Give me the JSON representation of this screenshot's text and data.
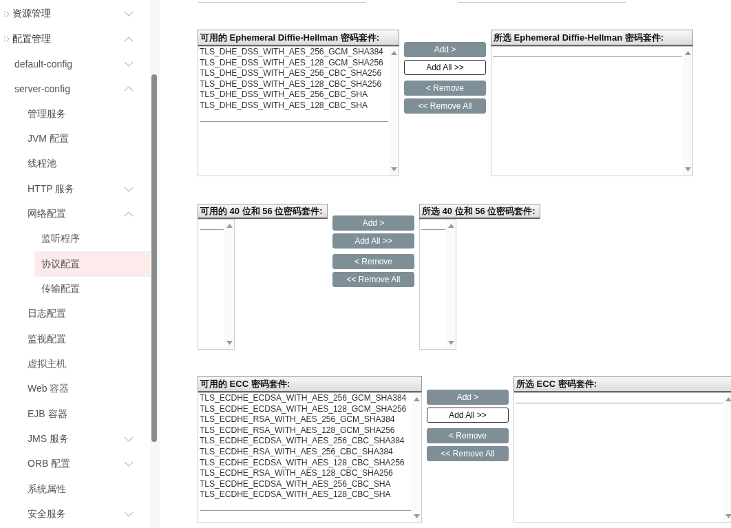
{
  "sidebar": {
    "items": [
      {
        "label": "资源管理",
        "selected": false,
        "expanded": false
      },
      {
        "label": "配置管理",
        "selected": false,
        "expanded": true,
        "children": [
          {
            "label": "default-config",
            "selected": false,
            "expanded": false
          },
          {
            "label": "server-config",
            "selected": false,
            "expanded": true,
            "children": [
              {
                "label": "管理服务",
                "selected": false
              },
              {
                "label": "JVM 配置",
                "selected": false
              },
              {
                "label": "线程池",
                "selected": false
              },
              {
                "label": "HTTP 服务",
                "selected": false,
                "expanded": false
              },
              {
                "label": "网络配置",
                "selected": false,
                "expanded": true,
                "children": [
                  {
                    "label": "监听程序",
                    "selected": false
                  },
                  {
                    "label": "协议配置",
                    "selected": true
                  },
                  {
                    "label": "传输配置",
                    "selected": false
                  }
                ]
              },
              {
                "label": "日志配置",
                "selected": false
              },
              {
                "label": "监视配置",
                "selected": false
              },
              {
                "label": "虚拟主机",
                "selected": false
              },
              {
                "label": "Web 容器",
                "selected": false
              },
              {
                "label": "EJB 容器",
                "selected": false
              },
              {
                "label": "JMS 服务",
                "selected": false,
                "expanded": false
              },
              {
                "label": "ORB 配置",
                "selected": false,
                "expanded": false
              },
              {
                "label": "系统属性",
                "selected": false
              },
              {
                "label": "安全服务",
                "selected": false,
                "expanded": false
              }
            ]
          }
        ]
      }
    ]
  },
  "sections": [
    {
      "available": {
        "title": "可用的 Ephemeral Diffie-Hellman 密码套件:",
        "options": [
          "TLS_DHE_DSS_WITH_AES_256_GCM_SHA384",
          "TLS_DHE_DSS_WITH_AES_128_GCM_SHA256",
          "TLS_DHE_DSS_WITH_AES_256_CBC_SHA256",
          "TLS_DHE_DSS_WITH_AES_128_CBC_SHA256",
          "TLS_DHE_DSS_WITH_AES_256_CBC_SHA",
          "TLS_DHE_DSS_WITH_AES_128_CBC_SHA"
        ]
      },
      "buttons": [
        {
          "label": "Add >",
          "disabled": true
        },
        {
          "label": "Add All >>",
          "disabled": false
        },
        {
          "label": "< Remove",
          "disabled": true
        },
        {
          "label": "<< Remove All",
          "disabled": true
        }
      ],
      "selected": {
        "title": "所选 Ephemeral Diffie-Hellman 密码套件:"
      }
    },
    {
      "available": {
        "title": "可用的 40 位和 56 位密码套件:"
      },
      "buttons": [
        {
          "label": "Add >",
          "disabled": true
        },
        {
          "label": "Add All >>",
          "disabled": true
        },
        {
          "label": "< Remove",
          "disabled": true
        },
        {
          "label": "<< Remove All",
          "disabled": true
        }
      ],
      "selected": {
        "title": "所选 40 位和 56 位密码套件:"
      }
    },
    {
      "available": {
        "title": "可用的 ECC 密码套件:",
        "options": [
          "TLS_ECDHE_ECDSA_WITH_AES_256_GCM_SHA384",
          "TLS_ECDHE_ECDSA_WITH_AES_128_GCM_SHA256",
          "TLS_ECDHE_RSA_WITH_AES_256_GCM_SHA384",
          "TLS_ECDHE_RSA_WITH_AES_128_GCM_SHA256",
          "TLS_ECDHE_ECDSA_WITH_AES_256_CBC_SHA384",
          "TLS_ECDHE_RSA_WITH_AES_256_CBC_SHA384",
          "TLS_ECDHE_ECDSA_WITH_AES_128_CBC_SHA256",
          "TLS_ECDHE_RSA_WITH_AES_128_CBC_SHA256",
          "TLS_ECDHE_ECDSA_WITH_AES_256_CBC_SHA",
          "TLS_ECDHE_ECDSA_WITH_AES_128_CBC_SHA"
        ]
      },
      "buttons": [
        {
          "label": "Add >",
          "disabled": true
        },
        {
          "label": "Add All >>",
          "disabled": false
        },
        {
          "label": "< Remove",
          "disabled": true
        },
        {
          "label": "<< Remove All",
          "disabled": true
        }
      ],
      "selected": {
        "title": "所选 ECC 密码套件:"
      }
    }
  ]
}
